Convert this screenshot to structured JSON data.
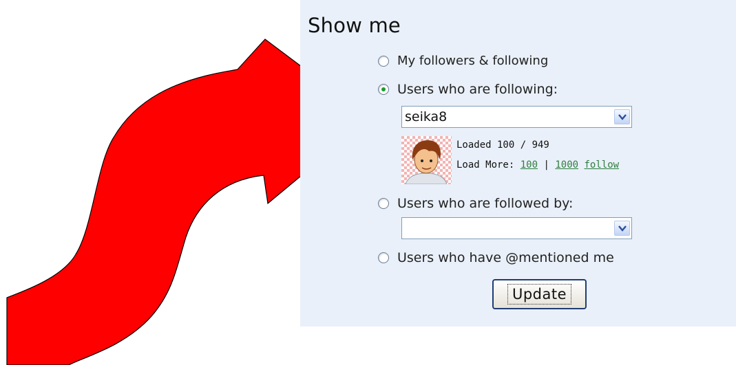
{
  "panel": {
    "title": "Show me",
    "options": [
      {
        "label": "My followers & following",
        "checked": false
      },
      {
        "label": "Users who are following:",
        "checked": true
      },
      {
        "label": "Users who are followed by:",
        "checked": false
      },
      {
        "label": "Users who have @mentioned me",
        "checked": false
      }
    ],
    "following_select": {
      "value": "seika8"
    },
    "followed_by_select": {
      "value": ""
    },
    "load_status": {
      "loaded_label": "Loaded 100 / 949",
      "load_more_label": "Load More:",
      "link_100": "100",
      "separator": "|",
      "link_1000": "1000",
      "link_follow": "follow"
    },
    "update_button": "Update"
  },
  "colors": {
    "arrow": "#ff0000",
    "panel_bg": "#e9f0f9",
    "link": "#2f7d3f",
    "radio_checked": "#1d9b2c"
  },
  "icons": {
    "arrow": "curved-arrow-icon",
    "dropdown": "chevron-down-icon",
    "avatar": "user-avatar"
  }
}
